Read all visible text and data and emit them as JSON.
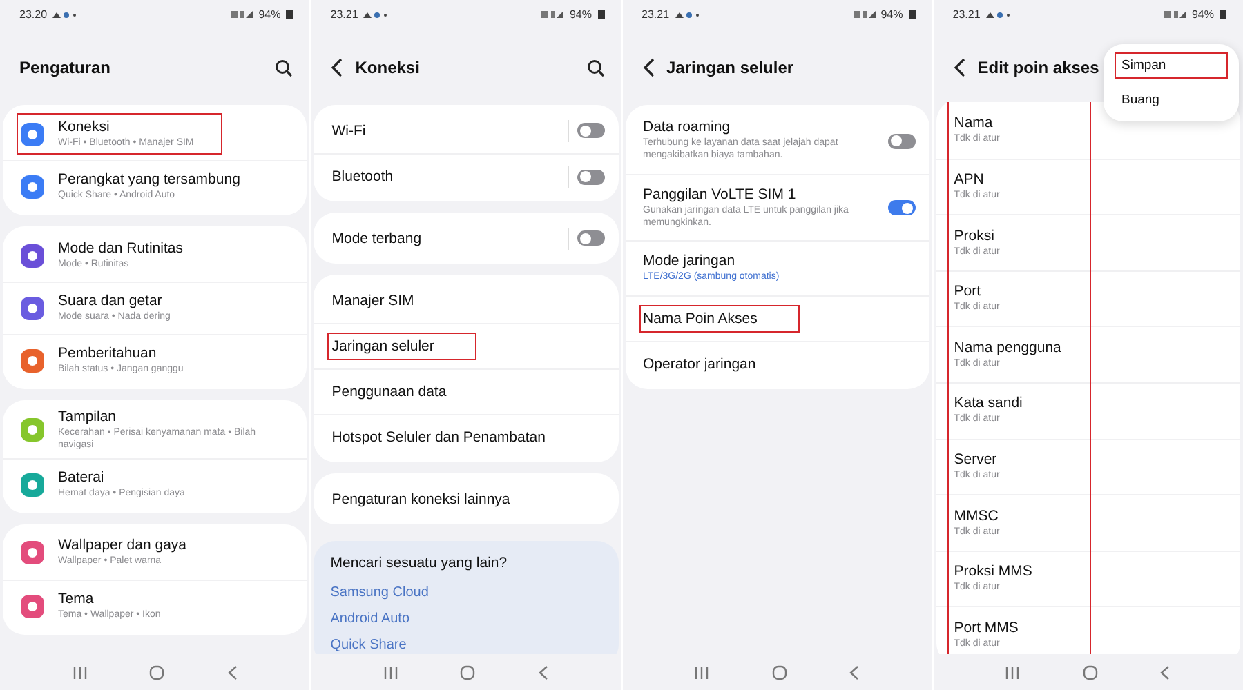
{
  "screens": [
    {
      "status_bar": {
        "time": "23.20",
        "battery": "94%"
      },
      "header": {
        "title": "Pengaturan",
        "back": false,
        "search": true
      },
      "groups": [
        {
          "highlighted": false,
          "items": [
            {
              "kind": "entry",
              "title": "Koneksi",
              "subtitle": "Wi-Fi  •  Bluetooth  •  Manajer SIM",
              "color": "#3b7cf5",
              "highlighted": true
            },
            {
              "kind": "entry",
              "title": "Perangkat yang tersambung",
              "subtitle": "Quick Share  •  Android Auto",
              "color": "#3b7cf5",
              "highlighted": false
            }
          ]
        },
        {
          "highlighted": false,
          "items": [
            {
              "kind": "entry",
              "title": "Mode dan Rutinitas",
              "subtitle": "Mode  •  Rutinitas",
              "color": "#6a4fd8",
              "highlighted": false
            },
            {
              "kind": "entry",
              "title": "Suara dan getar",
              "subtitle": "Mode suara  •  Nada dering",
              "color": "#6a5ce0",
              "highlighted": false
            },
            {
              "kind": "entry",
              "title": "Pemberitahuan",
              "subtitle": "Bilah status  •  Jangan ganggu",
              "color": "#e8622c",
              "highlighted": false
            }
          ]
        },
        {
          "highlighted": false,
          "items": [
            {
              "kind": "entry",
              "title": "Tampilan",
              "subtitle": "Kecerahan  •  Perisai kenyamanan mata  •  Bilah navigasi",
              "color": "#86c62c",
              "highlighted": false
            },
            {
              "kind": "entry",
              "title": "Baterai",
              "subtitle": "Hemat daya  •  Pengisian daya",
              "color": "#17a99a",
              "highlighted": false
            }
          ]
        },
        {
          "highlighted": false,
          "items": [
            {
              "kind": "entry",
              "title": "Wallpaper dan gaya",
              "subtitle": "Wallpaper  •  Palet warna",
              "color": "#e34c7c",
              "highlighted": false
            },
            {
              "kind": "entry",
              "title": "Tema",
              "subtitle": "Tema  •  Wallpaper  •  Ikon",
              "color": "#e34c7c",
              "highlighted": false
            }
          ]
        }
      ]
    },
    {
      "status_bar": {
        "time": "23.21",
        "battery": "94%"
      },
      "header": {
        "title": "Koneksi",
        "back": true,
        "search": true
      },
      "groups": [
        {
          "highlighted": false,
          "items": [
            {
              "kind": "split-toggle",
              "title": "Wi-Fi",
              "on": false,
              "highlighted": false
            },
            {
              "kind": "split-toggle",
              "title": "Bluetooth",
              "on": false,
              "highlighted": false
            }
          ]
        },
        {
          "highlighted": false,
          "items": [
            {
              "kind": "split-toggle",
              "title": "Mode terbang",
              "on": false,
              "highlighted": false
            }
          ]
        },
        {
          "highlighted": false,
          "items": [
            {
              "kind": "plain",
              "title": "Manajer SIM",
              "highlighted": false
            },
            {
              "kind": "plain",
              "title": "Jaringan seluler",
              "highlighted": true
            },
            {
              "kind": "plain",
              "title": "Penggunaan data",
              "highlighted": false
            },
            {
              "kind": "plain",
              "title": "Hotspot Seluler dan Penambatan",
              "highlighted": false
            }
          ]
        },
        {
          "highlighted": false,
          "items": [
            {
              "kind": "plain",
              "title": "Pengaturan koneksi lainnya",
              "highlighted": false
            }
          ]
        }
      ],
      "suggestion": {
        "title": "Mencari sesuatu yang lain?",
        "links": [
          "Samsung Cloud",
          "Android Auto",
          "Quick Share"
        ]
      }
    },
    {
      "status_bar": {
        "time": "23.21",
        "battery": "94%"
      },
      "header": {
        "title": "Jaringan seluler",
        "back": true,
        "search": false
      },
      "groups": [
        {
          "highlighted": false,
          "items": [
            {
              "kind": "toggle",
              "title": "Data roaming",
              "subtitle": "Terhubung ke layanan data saat jelajah dapat mengakibatkan biaya tambahan.",
              "on": false,
              "highlighted": false
            },
            {
              "kind": "toggle",
              "title": "Panggilan VoLTE SIM 1",
              "subtitle": "Gunakan jaringan data LTE untuk panggilan jika memungkinkan.",
              "on": true,
              "highlighted": false
            },
            {
              "kind": "value",
              "title": "Mode jaringan",
              "subtitle": "LTE/3G/2G (sambung otomatis)",
              "highlighted": false
            },
            {
              "kind": "plain",
              "title": "Nama Poin Akses",
              "highlighted": true
            },
            {
              "kind": "plain",
              "title": "Operator jaringan",
              "highlighted": false
            }
          ]
        }
      ]
    },
    {
      "status_bar": {
        "time": "23.21",
        "battery": "94%"
      },
      "header": {
        "title": "Edit poin akses",
        "back": true,
        "search": false
      },
      "menu": [
        {
          "label": "Simpan",
          "highlighted": true
        },
        {
          "label": "Buang",
          "highlighted": false
        }
      ],
      "groups": [
        {
          "highlighted": true,
          "items": [
            {
              "kind": "field",
              "title": "Nama",
              "subtitle": "Tdk di atur",
              "highlighted": false
            },
            {
              "kind": "field",
              "title": "APN",
              "subtitle": "Tdk di atur",
              "highlighted": false
            },
            {
              "kind": "field",
              "title": "Proksi",
              "subtitle": "Tdk di atur",
              "highlighted": false
            },
            {
              "kind": "field",
              "title": "Port",
              "subtitle": "Tdk di atur",
              "highlighted": false
            },
            {
              "kind": "field",
              "title": "Nama pengguna",
              "subtitle": "Tdk di atur",
              "highlighted": false
            },
            {
              "kind": "field",
              "title": "Kata sandi",
              "subtitle": "Tdk di atur",
              "highlighted": false
            },
            {
              "kind": "field",
              "title": "Server",
              "subtitle": "Tdk di atur",
              "highlighted": false
            },
            {
              "kind": "field",
              "title": "MMSC",
              "subtitle": "Tdk di atur",
              "highlighted": false
            },
            {
              "kind": "field",
              "title": "Proksi MMS",
              "subtitle": "Tdk di atur",
              "highlighted": false
            },
            {
              "kind": "field",
              "title": "Port MMS",
              "subtitle": "Tdk di atur",
              "highlighted": false
            }
          ]
        }
      ]
    }
  ]
}
